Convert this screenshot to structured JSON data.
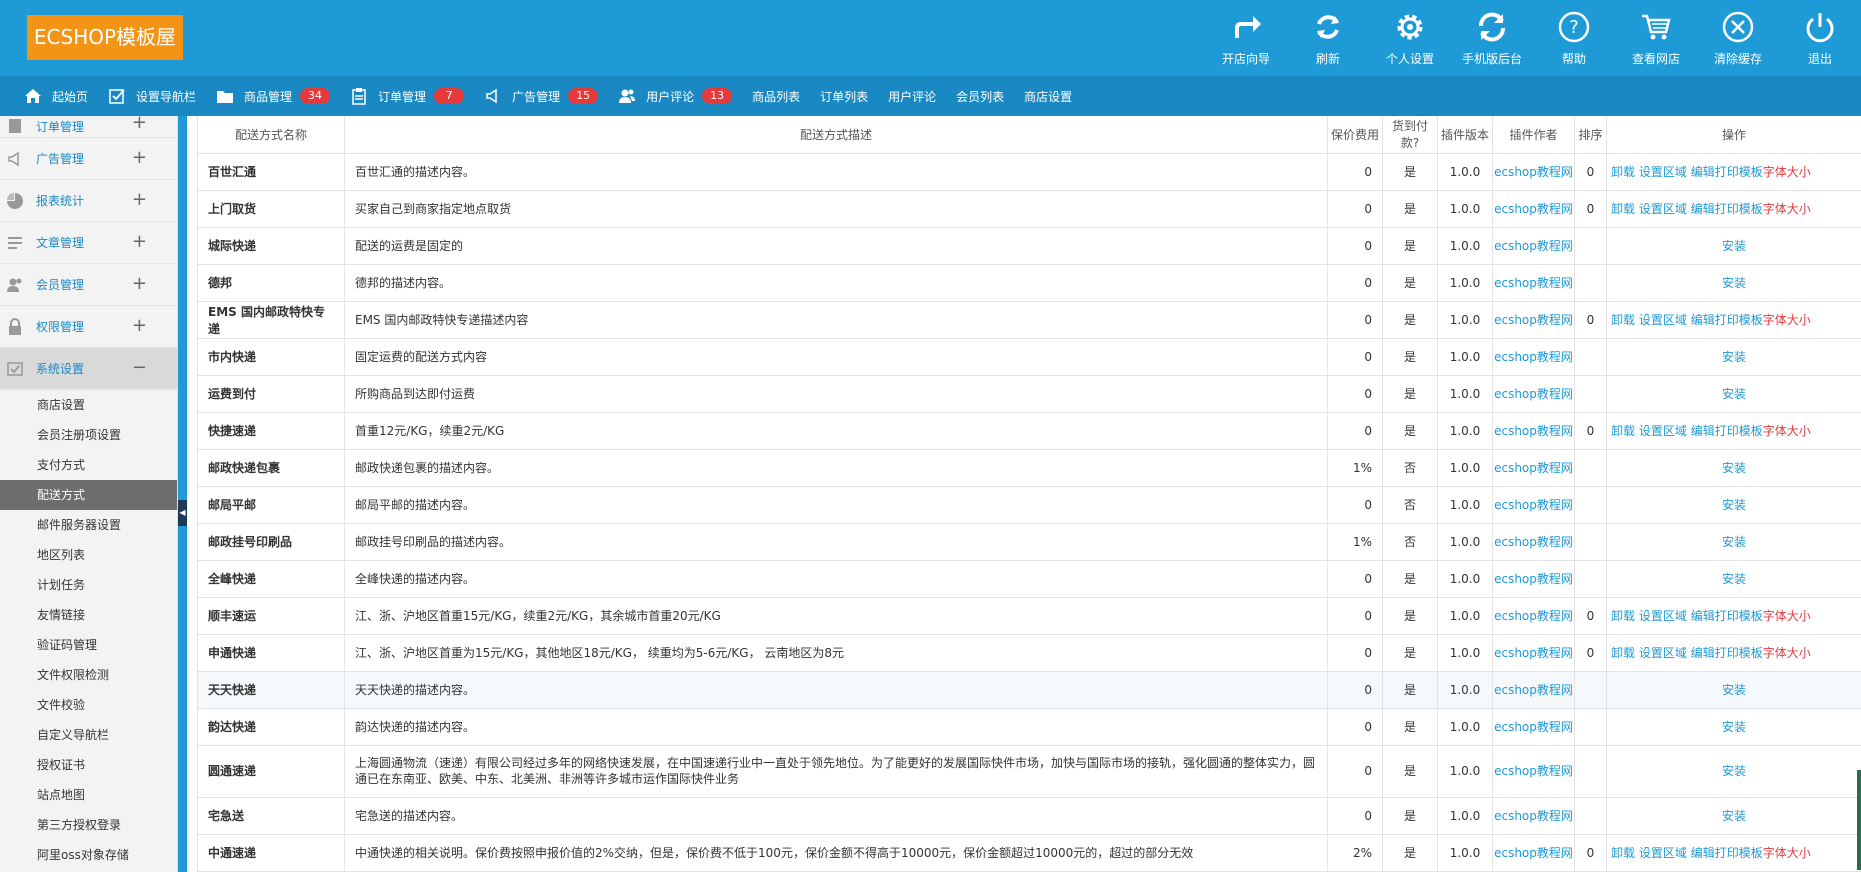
{
  "logo": "ECSHOP模板屋",
  "top_tools": [
    {
      "icon": "share-arrow-icon",
      "label": "开店向导"
    },
    {
      "icon": "refresh-icon",
      "label": "刷新"
    },
    {
      "icon": "gear-icon",
      "label": "个人设置"
    },
    {
      "icon": "sync-icon",
      "label": "手机版后台"
    },
    {
      "icon": "help-icon",
      "label": "帮助"
    },
    {
      "icon": "cart-icon",
      "label": "查看网店"
    },
    {
      "icon": "clear-icon",
      "label": "清除缓存"
    },
    {
      "icon": "power-icon",
      "label": "退出"
    }
  ],
  "nav": [
    {
      "icon": "home-icon",
      "label": "起始页"
    },
    {
      "icon": "nav-settings-icon",
      "label": "设置导航栏"
    },
    {
      "icon": "folder-icon",
      "label": "商品管理",
      "badge": "34"
    },
    {
      "icon": "clipboard-icon",
      "label": "订单管理",
      "badge": "7"
    },
    {
      "icon": "megaphone-icon",
      "label": "广告管理",
      "badge": "15"
    },
    {
      "icon": "users-icon",
      "label": "用户评论",
      "badge": "13"
    },
    {
      "label": "商品列表"
    },
    {
      "label": "订单列表"
    },
    {
      "label": "用户评论"
    },
    {
      "label": "会员列表"
    },
    {
      "label": "商店设置"
    }
  ],
  "sidebar": {
    "groups": [
      {
        "icon": "order-icon",
        "label": "订单管理",
        "toggle": "+"
      },
      {
        "icon": "megaphone-icon",
        "label": "广告管理",
        "toggle": "+"
      },
      {
        "icon": "pie-chart-icon",
        "label": "报表统计",
        "toggle": "+"
      },
      {
        "icon": "list-icon",
        "label": "文章管理",
        "toggle": "+"
      },
      {
        "icon": "member-icon",
        "label": "会员管理",
        "toggle": "+"
      },
      {
        "icon": "lock-icon",
        "label": "权限管理",
        "toggle": "+"
      },
      {
        "icon": "settings-check-icon",
        "label": "系统设置",
        "toggle": "−"
      }
    ],
    "sub_items": [
      "商店设置",
      "会员注册项设置",
      "支付方式",
      "配送方式",
      "邮件服务器设置",
      "地区列表",
      "计划任务",
      "友情链接",
      "验证码管理",
      "文件权限检测",
      "文件校验",
      "自定义导航栏",
      "授权证书",
      "站点地图",
      "第三方授权登录",
      "阿里oss对象存储"
    ],
    "current": "配送方式"
  },
  "table": {
    "headers": [
      "配送方式名称",
      "配送方式描述",
      "保价费用",
      "货到付款?",
      "插件版本",
      "插件作者",
      "排序",
      "操作"
    ],
    "op_labels": {
      "uninstall": "卸载",
      "set_area": "设置区域",
      "edit_print": "编辑打印模板",
      "font_size": "字体大小",
      "install": "安装"
    },
    "rows": [
      {
        "name": "百世汇通",
        "desc": "百世汇通的描述内容。",
        "fee": "0",
        "cod": "是",
        "ver": "1.0.0",
        "author": "ecshop教程网",
        "order": "0",
        "installed": true
      },
      {
        "name": "上门取货",
        "desc": "买家自己到商家指定地点取货",
        "fee": "0",
        "cod": "是",
        "ver": "1.0.0",
        "author": "ecshop教程网",
        "order": "0",
        "installed": true
      },
      {
        "name": "城际快递",
        "desc": "配送的运费是固定的",
        "fee": "0",
        "cod": "是",
        "ver": "1.0.0",
        "author": "ecshop教程网",
        "order": "",
        "installed": false
      },
      {
        "name": "德邦",
        "desc": "德邦的描述内容。",
        "fee": "0",
        "cod": "是",
        "ver": "1.0.0",
        "author": "ecshop教程网",
        "order": "",
        "installed": false
      },
      {
        "name": "EMS 国内邮政特快专递",
        "desc": "EMS 国内邮政特快专递描述内容",
        "fee": "0",
        "cod": "是",
        "ver": "1.0.0",
        "author": "ecshop教程网",
        "order": "0",
        "installed": true
      },
      {
        "name": "市内快递",
        "desc": "固定运费的配送方式内容",
        "fee": "0",
        "cod": "是",
        "ver": "1.0.0",
        "author": "ecshop教程网",
        "order": "",
        "installed": false
      },
      {
        "name": "运费到付",
        "desc": "所购商品到达即付运费",
        "fee": "0",
        "cod": "是",
        "ver": "1.0.0",
        "author": "ecshop教程网",
        "order": "",
        "installed": false
      },
      {
        "name": "快捷速递",
        "desc": "首重12元/KG，续重2元/KG",
        "fee": "0",
        "cod": "是",
        "ver": "1.0.0",
        "author": "ecshop教程网",
        "order": "0",
        "installed": true
      },
      {
        "name": "邮政快递包裹",
        "desc": "邮政快递包裹的描述内容。",
        "fee": "1%",
        "cod": "否",
        "ver": "1.0.0",
        "author": "ecshop教程网",
        "order": "",
        "installed": false
      },
      {
        "name": "邮局平邮",
        "desc": "邮局平邮的描述内容。",
        "fee": "0",
        "cod": "否",
        "ver": "1.0.0",
        "author": "ecshop教程网",
        "order": "",
        "installed": false
      },
      {
        "name": "邮政挂号印刷品",
        "desc": "邮政挂号印刷品的描述内容。",
        "fee": "1%",
        "cod": "否",
        "ver": "1.0.0",
        "author": "ecshop教程网",
        "order": "",
        "installed": false
      },
      {
        "name": "全峰快递",
        "desc": "全峰快递的描述内容。",
        "fee": "0",
        "cod": "是",
        "ver": "1.0.0",
        "author": "ecshop教程网",
        "order": "",
        "installed": false
      },
      {
        "name": "顺丰速运",
        "desc": "江、浙、沪地区首重15元/KG，续重2元/KG，其余城市首重20元/KG",
        "fee": "0",
        "cod": "是",
        "ver": "1.0.0",
        "author": "ecshop教程网",
        "order": "0",
        "installed": true
      },
      {
        "name": "申通快递",
        "desc": "江、浙、沪地区首重为15元/KG，其他地区18元/KG， 续重均为5-6元/KG， 云南地区为8元",
        "fee": "0",
        "cod": "是",
        "ver": "1.0.0",
        "author": "ecshop教程网",
        "order": "0",
        "installed": true
      },
      {
        "name": "天天快递",
        "desc": "天天快递的描述内容。",
        "fee": "0",
        "cod": "是",
        "ver": "1.0.0",
        "author": "ecshop教程网",
        "order": "",
        "installed": false,
        "highlight": true
      },
      {
        "name": "韵达快递",
        "desc": "韵达快递的描述内容。",
        "fee": "0",
        "cod": "是",
        "ver": "1.0.0",
        "author": "ecshop教程网",
        "order": "",
        "installed": false
      },
      {
        "name": "圆通速递",
        "desc": "上海圆通物流（速递）有限公司经过多年的网络快速发展，在中国速递行业中一直处于领先地位。为了能更好的发展国际快件市场，加快与国际市场的接轨，强化圆通的整体实力，圆通已在东南亚、欧美、中东、北美洲、非洲等许多城市运作国际快件业务",
        "fee": "0",
        "cod": "是",
        "ver": "1.0.0",
        "author": "ecshop教程网",
        "order": "",
        "installed": false,
        "tall": true
      },
      {
        "name": "宅急送",
        "desc": "宅急送的描述内容。",
        "fee": "0",
        "cod": "是",
        "ver": "1.0.0",
        "author": "ecshop教程网",
        "order": "",
        "installed": false
      },
      {
        "name": "中通速递",
        "desc": "中通快递的相关说明。保价费按照申报价值的2%交纳，但是，保价费不低于100元，保价金额不得高于10000元，保价金额超过10000元的，超过的部分无效",
        "fee": "2%",
        "cod": "是",
        "ver": "1.0.0",
        "author": "ecshop教程网",
        "order": "0",
        "installed": true
      }
    ]
  },
  "colors": {
    "header": "#1e9ad6",
    "navbar": "#1a89c3",
    "logo": "#f39417",
    "badge": "#e5393c",
    "link": "#1e9ad6"
  }
}
